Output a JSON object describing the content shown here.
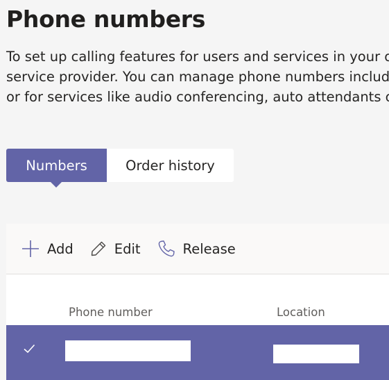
{
  "page": {
    "title": "Phone numbers",
    "description_lines": [
      "To set up calling features for users and services in your orga",
      "service provider. You can manage phone numbers including",
      "or for services like audio conferencing, auto attendants or ca"
    ]
  },
  "tabs": [
    {
      "label": "Numbers",
      "selected": true
    },
    {
      "label": "Order history",
      "selected": false
    }
  ],
  "toolbar": {
    "add_label": "Add",
    "edit_label": "Edit",
    "release_label": "Release"
  },
  "table": {
    "columns": [
      "Phone number",
      "Location"
    ],
    "rows": [
      {
        "selected": true,
        "phone_number": "",
        "location": ""
      }
    ]
  },
  "colors": {
    "accent": "#6264a7",
    "background": "#f5f5f5",
    "panel": "#ffffff",
    "toolbar": "#faf9f8"
  },
  "icons": {
    "add": "plus-icon",
    "edit": "pencil-icon",
    "release": "phone-icon",
    "row_selected": "checkmark-icon"
  }
}
